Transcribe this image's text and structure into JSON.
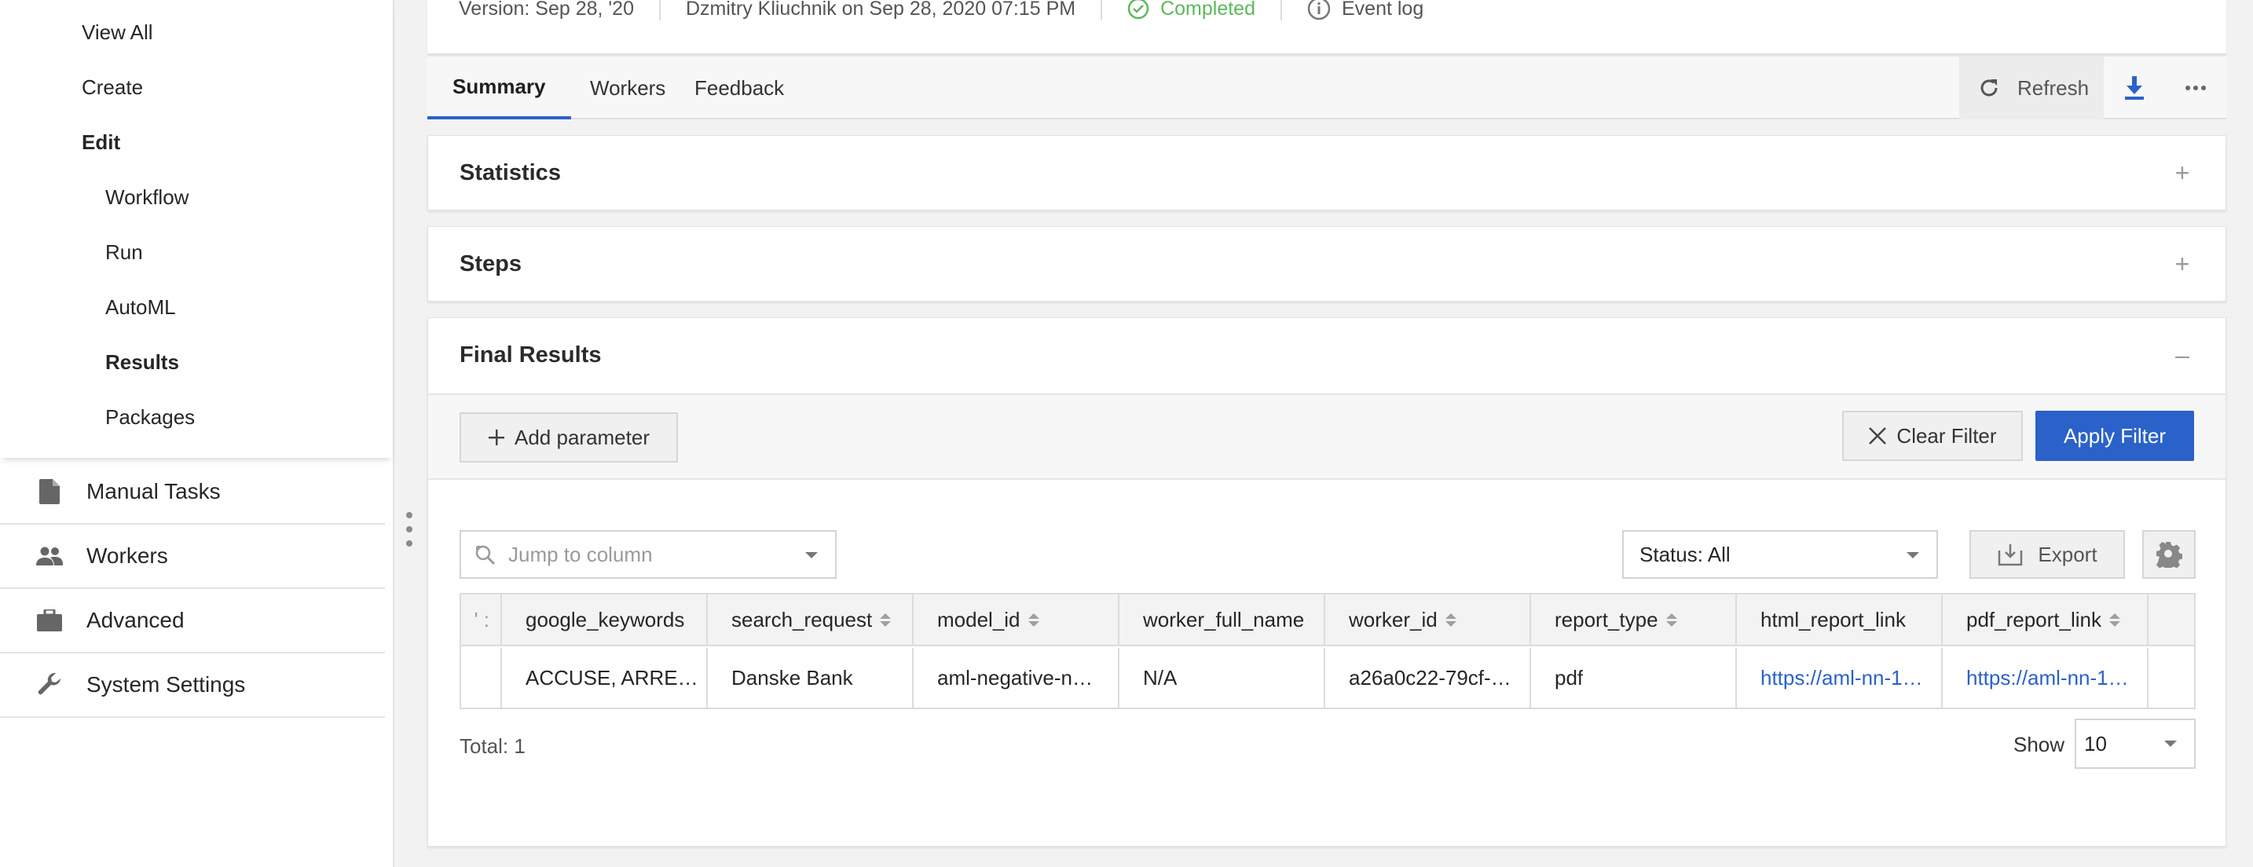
{
  "sidebar": {
    "subnav": [
      {
        "label": "View All",
        "bold": false
      },
      {
        "label": "Create",
        "bold": false
      },
      {
        "label": "Edit",
        "bold": true
      },
      {
        "label": "Workflow",
        "bold": false
      },
      {
        "label": "Run",
        "bold": false
      },
      {
        "label": "AutoML",
        "bold": false
      },
      {
        "label": "Results",
        "bold": true
      },
      {
        "label": "Packages",
        "bold": false
      }
    ],
    "mainnav": [
      {
        "label": "Manual Tasks",
        "icon": "document-icon"
      },
      {
        "label": "Workers",
        "icon": "people-icon"
      },
      {
        "label": "Advanced",
        "icon": "briefcase-icon"
      },
      {
        "label": "System Settings",
        "icon": "wrench-icon"
      }
    ]
  },
  "header": {
    "version": "Version: Sep 28, '20",
    "author": "Dzmitry Kliuchnik on Sep 28, 2020 07:15 PM",
    "status": "Completed",
    "event_log": "Event log",
    "status_color": "#5cb85c"
  },
  "tabs": {
    "items": [
      {
        "label": "Summary",
        "active": true
      },
      {
        "label": "Workers",
        "active": false
      },
      {
        "label": "Feedback",
        "active": false
      }
    ],
    "refresh_label": "Refresh",
    "accent": "#2a62c9"
  },
  "panels": {
    "statistics": {
      "title": "Statistics",
      "toggle": "+"
    },
    "steps": {
      "title": "Steps",
      "toggle": "+"
    },
    "final_results": {
      "title": "Final Results",
      "toggle": "–"
    }
  },
  "filters": {
    "add_parameter": "Add parameter",
    "clear_filter": "Clear Filter",
    "apply_filter": "Apply Filter"
  },
  "toolbar": {
    "jump_placeholder": "Jump to column",
    "status_value": "Status: All",
    "export_label": "Export"
  },
  "table": {
    "stub_header": "' :",
    "columns": [
      {
        "label": "google_keywords",
        "sortable": false
      },
      {
        "label": "search_request",
        "sortable": true
      },
      {
        "label": "model_id",
        "sortable": true
      },
      {
        "label": "worker_full_name",
        "sortable": false
      },
      {
        "label": "worker_id",
        "sortable": true
      },
      {
        "label": "report_type",
        "sortable": true
      },
      {
        "label": "html_report_link",
        "sortable": false
      },
      {
        "label": "pdf_report_link",
        "sortable": true
      }
    ],
    "rows": [
      [
        "ACCUSE, ARRE…",
        "Danske Bank",
        "aml-negative-n…",
        "N/A",
        "a26a0c22-79cf-…",
        "pdf",
        "https://aml-nn-1…",
        "https://aml-nn-1…"
      ]
    ],
    "link_columns": [
      6,
      7
    ]
  },
  "footer": {
    "total": "Total: 1",
    "show_label": "Show",
    "page_size": "10"
  }
}
